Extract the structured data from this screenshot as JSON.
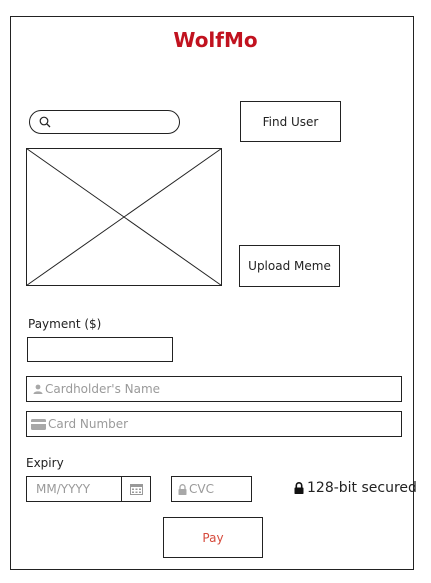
{
  "app": {
    "title": "WolfMo",
    "title_color": "#c1121f"
  },
  "search": {
    "placeholder": "",
    "icon": "search-icon"
  },
  "buttons": {
    "find_user": "Find User",
    "upload_meme": "Upload Meme",
    "pay": "Pay",
    "pay_color": "#d64a3c"
  },
  "image_placeholder": {
    "icon": "image-placeholder-cross"
  },
  "payment": {
    "amount_label": "Payment ($)",
    "amount_value": "",
    "cardholder_placeholder": "Cardholder's Name",
    "card_number_placeholder": "Card Number",
    "expiry_label": "Expiry",
    "expiry_placeholder": "MM/YYYY",
    "cvc_placeholder": "CVC",
    "secured_text": "128-bit secured"
  }
}
